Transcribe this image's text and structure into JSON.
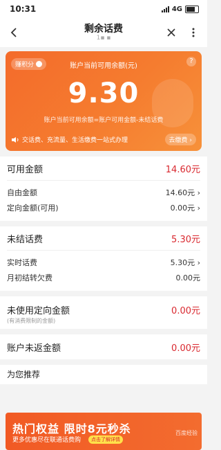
{
  "status": {
    "time": "10:31",
    "network": "4G"
  },
  "nav": {
    "title": "剩余话费",
    "subtitle": "1▪ ▪",
    "back_icon": "chevron-left-icon",
    "close_icon": "close-icon",
    "more_icon": "more-icon"
  },
  "card": {
    "points_label": "赚积分",
    "label": "账户当前可用余额(元)",
    "amount": "9.30",
    "formula": "账户当前可用余额=账户可用金额-未结话费",
    "bottom_text": "交话费、充流量、生活缴费一站式办理",
    "pay_button": "去缴费 ›",
    "help": "?"
  },
  "balances": {
    "available": {
      "label": "可用金额",
      "value": "14.60元"
    },
    "free": {
      "label": "自由金额",
      "value": "14.60元 ›"
    },
    "targeted": {
      "label": "定向金额(可用)",
      "value": "0.00元 ›"
    }
  },
  "unsettled": {
    "total": {
      "label": "未结话费",
      "value": "5.30元"
    },
    "realtime": {
      "label": "实时话费",
      "value": "5.30元 ›"
    },
    "carryover": {
      "label": "月初结转欠费",
      "value": "0.00元"
    }
  },
  "unused_targeted": {
    "label": "未使用定向金额",
    "value": "0.00元",
    "note": "(有消费限制的金额)"
  },
  "unreturned": {
    "label": "账户未返金额",
    "value": "0.00元"
  },
  "recommend": {
    "title": "为您推荐",
    "banner_title": "热门权益  限时8元秒杀",
    "banner_sub": "更多优惠尽在联通话费购",
    "banner_tag": "点击了解详情",
    "watermark": "百度经验"
  },
  "colors": {
    "accent": "#f46b2b",
    "value_red": "#d9282f"
  }
}
